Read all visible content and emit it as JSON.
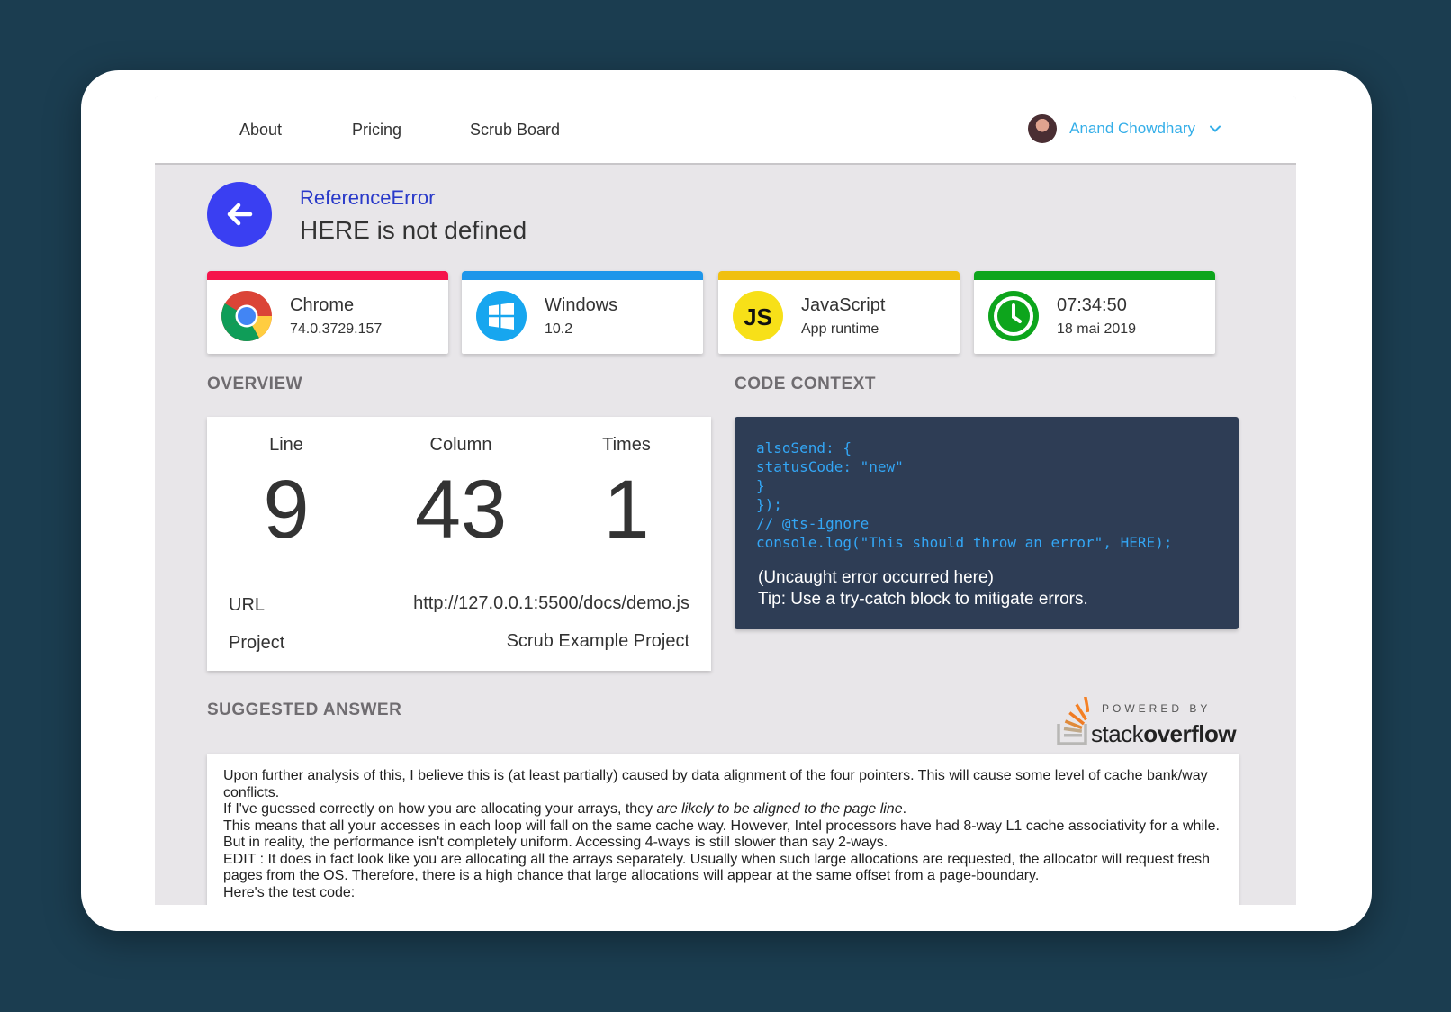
{
  "nav": {
    "links": [
      "About",
      "Pricing",
      "Scrub Board"
    ],
    "user_name": "Anand Chowdhary"
  },
  "error": {
    "type": "ReferenceError",
    "message": "HERE is not defined"
  },
  "cards": [
    {
      "title": "Chrome",
      "sub": "74.0.3729.157",
      "accent": "#f5144b",
      "icon": "chrome-icon"
    },
    {
      "title": "Windows",
      "sub": "10.2",
      "accent": "#1e96ea",
      "icon": "windows-icon"
    },
    {
      "title": "JavaScript",
      "sub": "App runtime",
      "accent": "#f0c010",
      "icon": "javascript-icon",
      "icon_text": "JS"
    },
    {
      "title": "07:34:50",
      "sub": "18 mai 2019",
      "accent": "#0da51c",
      "icon": "clock-icon"
    }
  ],
  "overview": {
    "label": "OVERVIEW",
    "line_label": "Line",
    "line_value": "9",
    "column_label": "Column",
    "column_value": "43",
    "times_label": "Times",
    "times_value": "1",
    "url_label": "URL",
    "url_value": "http://127.0.0.1:5500/docs/demo.js",
    "project_label": "Project",
    "project_value": "Scrub Example Project"
  },
  "code_context": {
    "label": "CODE CONTEXT",
    "code": "alsoSend: {\nstatusCode: \"new\"\n}\n});\n// @ts-ignore\nconsole.log(\"This should throw an error\", HERE);",
    "note_1": "(Uncaught error occurred here)",
    "note_2": "Tip: Use a try-catch block to mitigate errors."
  },
  "suggested": {
    "label": "SUGGESTED ANSWER",
    "powered": "POWERED BY",
    "brand_light": "stack",
    "brand_bold": "overflow",
    "p1": "Upon further analysis of this, I believe this is (at least partially) caused by data alignment of the four pointers. This will cause some level of cache bank/way conflicts.",
    "p2_start": "If I've guessed correctly on how you are allocating your arrays, they ",
    "p2_em": "are likely to be aligned to the page line",
    "p2_end": ".",
    "p3": "This means that all your accesses in each loop will fall on the same cache way. However, Intel processors have had 8-way L1 cache associativity for a while. But in reality, the performance isn't completely uniform. Accessing 4-ways is still slower than say 2-ways.",
    "p4": "EDIT : It does in fact look like you are allocating all the arrays separately. Usually when such large allocations are requested, the allocator will request fresh pages from the OS. Therefore, there is a high chance that large allocations will appear at the same offset from a page-boundary.",
    "p5": "Here's the test code:"
  }
}
